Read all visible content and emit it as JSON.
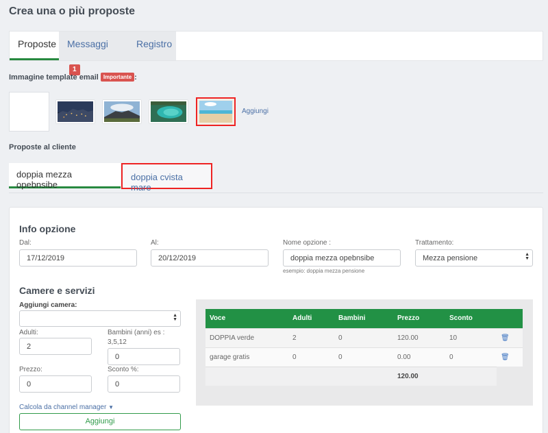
{
  "page": {
    "title": "Crea una o più proposte"
  },
  "tabs": [
    {
      "label": "Proposte"
    },
    {
      "label": "Messaggi",
      "badge": "1"
    },
    {
      "label": "Registro"
    }
  ],
  "email_template": {
    "label": "Immagine template email",
    "badge": "Importante",
    "colon": ":",
    "add_label": "Aggiungi",
    "thumbnails": [
      "city-night-image",
      "volcano-image",
      "lagoon-image",
      "beach-image"
    ],
    "selected_index": 3
  },
  "proposals": {
    "label": "Proposte al cliente",
    "tabs": [
      "doppia mezza opebnsibe",
      "doppia cvista mare"
    ]
  },
  "info": {
    "title": "Info opzione",
    "dal_label": "Dal:",
    "dal_value": "17/12/2019",
    "al_label": "Al:",
    "al_value": "20/12/2019",
    "nome_label": "Nome opzione :",
    "nome_value": "doppia mezza opebnsibe",
    "nome_help": "esempio: doppia mezza pensione",
    "trattamento_label": "Trattamento:",
    "trattamento_value": "Mezza pensione"
  },
  "rooms": {
    "title": "Camere e servizi",
    "add_room_label": "Aggiungi camera:",
    "adulti_label": "Adulti:",
    "adulti_value": "2",
    "bambini_label": "Bambini (anni) es :",
    "bambini_hint": "3,5,12",
    "bambini_value": "0",
    "prezzo_label": "Prezzo:",
    "prezzo_value": "0",
    "sconto_label": "Sconto %:",
    "sconto_value": "0",
    "channel_link": "Calcola da channel manager",
    "add_button": "Aggiungi"
  },
  "table": {
    "headers": [
      "Voce",
      "Adulti",
      "Bambini",
      "Prezzo",
      "Sconto"
    ],
    "rows": [
      [
        "DOPPIA verde",
        "2",
        "0",
        "120.00",
        "10"
      ],
      [
        "garage gratis",
        "0",
        "0",
        "0.00",
        "0"
      ]
    ],
    "total": "120.00"
  },
  "colors": {
    "accent_green": "#229145",
    "badge_red": "#d9534f",
    "link_blue": "#4a6fa5",
    "selected_border": "#ee2222"
  }
}
